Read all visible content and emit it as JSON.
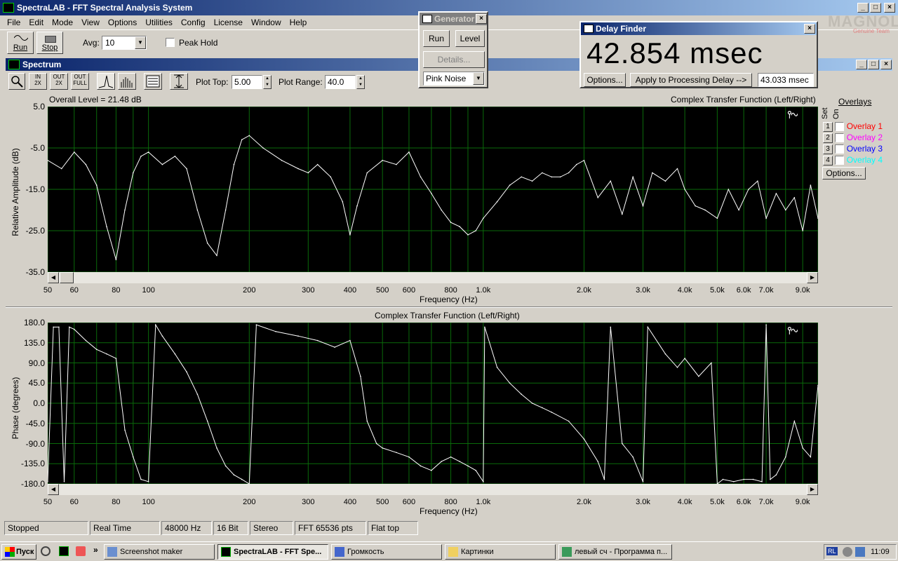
{
  "app": {
    "title": "SpectraLAB - FFT Spectral Analysis System"
  },
  "menu": [
    "File",
    "Edit",
    "Mode",
    "View",
    "Options",
    "Utilities",
    "Config",
    "License",
    "Window",
    "Help"
  ],
  "toolbar": {
    "run": "Run",
    "stop": "Stop",
    "avg_label": "Avg:",
    "avg_value": "10",
    "peak_hold": "Peak Hold"
  },
  "generator": {
    "title": "Generator",
    "run": "Run",
    "level": "Level",
    "details": "Details...",
    "signal": "Pink Noise"
  },
  "delay": {
    "title": "Delay Finder",
    "value": "42.854 msec",
    "options": "Options...",
    "apply": "Apply to Processing Delay -->",
    "processing": "43.033 msec"
  },
  "watermark": {
    "text": "MAGNOLA",
    "sub": "Genuine Team"
  },
  "spectrum": {
    "title": "Spectrum",
    "plot_top_label": "Plot Top:",
    "plot_top": "5.00",
    "plot_range_label": "Plot Range:",
    "plot_range": "40.0",
    "overall": "Overall Level = 21.48 dB",
    "amp_title": "Complex Transfer Function (Left/Right)",
    "phase_title": "Complex Transfer Function (Left/Right)",
    "amp_ylabel": "Relative Amplitude (dB)",
    "phase_ylabel": "Phase (degrees)",
    "xlabel": "Frequency (Hz)"
  },
  "overlays": {
    "title": "Overlays",
    "set": "Set",
    "on": "On",
    "items": [
      {
        "n": "1",
        "label": "Overlay 1",
        "color": "#ff0000"
      },
      {
        "n": "2",
        "label": "Overlay 2",
        "color": "#ff00ff"
      },
      {
        "n": "3",
        "label": "Overlay 3",
        "color": "#0000ff"
      },
      {
        "n": "4",
        "label": "Overlay 4",
        "color": "#00ffff"
      }
    ],
    "options": "Options..."
  },
  "chart_data": [
    {
      "type": "line",
      "title": "Complex Transfer Function (Left/Right)",
      "ylabel": "Relative Amplitude (dB)",
      "xlabel": "Frequency (Hz)",
      "xscale": "log",
      "xlim": [
        50,
        10000
      ],
      "ylim": [
        -35,
        5
      ],
      "yticks": [
        "5.0",
        "-5.0",
        "-15.0",
        "-25.0",
        "-35.0"
      ],
      "xticks": [
        "50",
        "60",
        "80",
        "100",
        "200",
        "300",
        "400",
        "500",
        "600",
        "800",
        "1.0k",
        "2.0k",
        "3.0k",
        "4.0k",
        "5.0k",
        "6.0k",
        "7.0k",
        "9.0k"
      ],
      "x": [
        50,
        55,
        60,
        65,
        70,
        75,
        80,
        85,
        90,
        95,
        100,
        110,
        120,
        130,
        140,
        150,
        160,
        170,
        180,
        190,
        200,
        220,
        250,
        280,
        300,
        320,
        350,
        380,
        400,
        420,
        450,
        500,
        550,
        600,
        650,
        700,
        750,
        800,
        850,
        900,
        950,
        1000,
        1100,
        1200,
        1300,
        1400,
        1500,
        1600,
        1700,
        1800,
        1900,
        2000,
        2200,
        2400,
        2600,
        2800,
        3000,
        3200,
        3500,
        3800,
        4000,
        4300,
        4600,
        5000,
        5400,
        5800,
        6200,
        6600,
        7000,
        7500,
        8000,
        8500,
        9000,
        9500,
        10000
      ],
      "y": [
        -8,
        -10,
        -6,
        -9,
        -14,
        -24,
        -32,
        -20,
        -11,
        -7,
        -6,
        -9,
        -7,
        -10,
        -20,
        -28,
        -31,
        -20,
        -9,
        -3,
        -2,
        -5,
        -8,
        -10,
        -11,
        -9,
        -12,
        -18,
        -26,
        -19,
        -11,
        -8,
        -9,
        -6,
        -12,
        -16,
        -20,
        -23,
        -24,
        -26,
        -25,
        -22,
        -18,
        -14,
        -12,
        -13,
        -11,
        -12,
        -12,
        -11,
        -9,
        -8,
        -17,
        -13,
        -21,
        -12,
        -19,
        -11,
        -13,
        -10,
        -15,
        -19,
        -20,
        -22,
        -15,
        -20,
        -15,
        -13,
        -22,
        -16,
        -20,
        -17,
        -25,
        -14,
        -22
      ]
    },
    {
      "type": "line",
      "title": "Complex Transfer Function (Left/Right)",
      "ylabel": "Phase (degrees)",
      "xlabel": "Frequency (Hz)",
      "xscale": "log",
      "xlim": [
        50,
        10000
      ],
      "ylim": [
        -180,
        180
      ],
      "yticks": [
        "180.0",
        "135.0",
        "90.0",
        "45.0",
        "0.0",
        "-45.0",
        "-90.0",
        "-135.0",
        "-180.0"
      ],
      "xticks": [
        "50",
        "60",
        "80",
        "100",
        "200",
        "300",
        "400",
        "500",
        "600",
        "800",
        "1.0k",
        "2.0k",
        "3.0k",
        "4.0k",
        "5.0k",
        "6.0k",
        "7.0k",
        "9.0k"
      ],
      "x": [
        50,
        52,
        54,
        56,
        58,
        60,
        65,
        70,
        75,
        80,
        85,
        90,
        95,
        100,
        105,
        110,
        120,
        130,
        140,
        150,
        160,
        170,
        180,
        190,
        200,
        210,
        240,
        280,
        320,
        360,
        400,
        430,
        450,
        480,
        500,
        550,
        600,
        650,
        700,
        750,
        800,
        850,
        900,
        950,
        1000,
        1010,
        1100,
        1200,
        1300,
        1400,
        1500,
        1600,
        1800,
        2000,
        2200,
        2300,
        2400,
        2600,
        2800,
        3000,
        3100,
        3500,
        3800,
        4000,
        4400,
        4800,
        5000,
        5200,
        5600,
        6000,
        6400,
        6800,
        7000,
        7200,
        7500,
        8000,
        8500,
        9000,
        9500,
        10000
      ],
      "y": [
        -175,
        170,
        170,
        -175,
        170,
        165,
        140,
        120,
        110,
        100,
        -60,
        -120,
        -170,
        -175,
        175,
        150,
        110,
        70,
        20,
        -40,
        -100,
        -140,
        -160,
        -170,
        -180,
        175,
        160,
        150,
        140,
        125,
        140,
        60,
        -40,
        -90,
        -100,
        -110,
        -120,
        -140,
        -150,
        -130,
        -120,
        -130,
        -140,
        -150,
        -175,
        170,
        80,
        45,
        20,
        0,
        -10,
        -20,
        -40,
        -80,
        -130,
        -170,
        170,
        -90,
        -120,
        -175,
        170,
        110,
        80,
        100,
        60,
        90,
        -180,
        -170,
        -175,
        -170,
        -170,
        -175,
        175,
        -170,
        -160,
        -120,
        -40,
        -100,
        -120,
        40
      ]
    }
  ],
  "status": [
    "Stopped",
    "Real Time",
    "48000 Hz",
    "16 Bit",
    "Stereo",
    "FFT 65536 pts",
    "Flat top"
  ],
  "taskbar": {
    "start": "Пуск",
    "tasks": [
      "Screenshot maker",
      "SpectraLAB - FFT Spe...",
      "Громкость",
      "Картинки",
      "левый сч - Программа п..."
    ],
    "lang": "RL",
    "clock": "11:09"
  }
}
